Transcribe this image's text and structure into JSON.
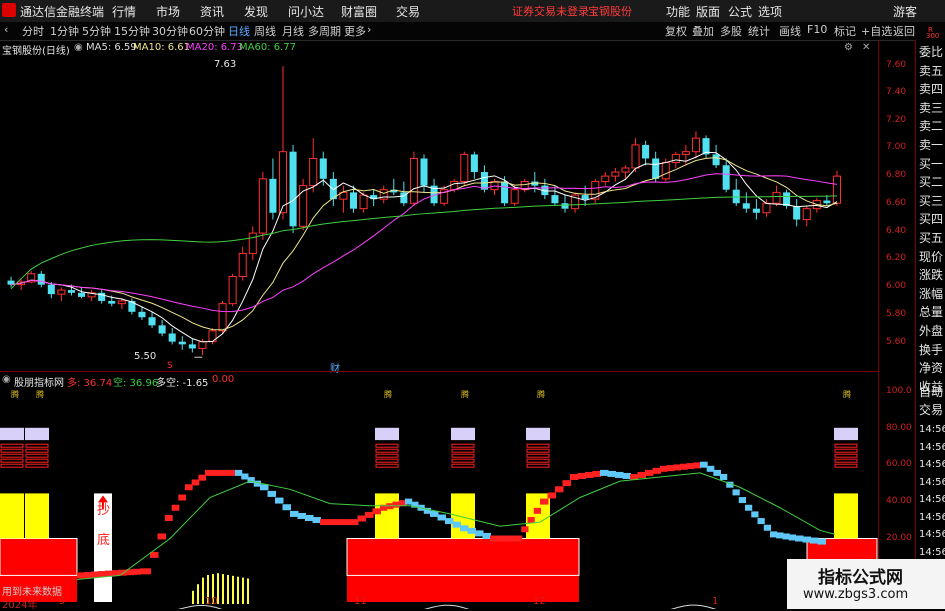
{
  "app": {
    "title": "通达信金融终端",
    "logo_color": "#d40000"
  },
  "menu": {
    "items": [
      "行情",
      "市场",
      "资讯",
      "发现",
      "问小达",
      "财富圈",
      "交易"
    ],
    "notice": "证券交易未登录",
    "stock": "宝钢股份",
    "right": [
      "功能",
      "版面",
      "公式",
      "选项"
    ],
    "user": "游客"
  },
  "toolbar": {
    "periods": [
      "分时",
      "1分钟",
      "5分钟",
      "15分钟",
      "30分钟",
      "60分钟",
      "日线",
      "周线",
      "月线",
      "多周期",
      "更多"
    ],
    "active": "日线",
    "right": [
      "复权",
      "叠加",
      "多股",
      "统计",
      "画线",
      "F10",
      "标记",
      "+自选",
      "返回"
    ]
  },
  "main_chart": {
    "title": "宝钢股份(日线)",
    "ma": [
      {
        "label": "MA5: 6.59",
        "color": "#ffffff"
      },
      {
        "label": "MA10: 6.61",
        "color": "#f0e68c"
      },
      {
        "label": "MA20: 6.73",
        "color": "#ff40ff"
      },
      {
        "label": "MA60: 6.77",
        "color": "#40d040"
      }
    ],
    "high_label": "7.63",
    "low_label": "5.50",
    "marker_s": "S",
    "marker_cai": "财",
    "y_ticks": [
      "7.60",
      "7.40",
      "7.20",
      "7.00",
      "6.80",
      "6.60",
      "6.40",
      "6.20",
      "6.00",
      "5.80",
      "5.60"
    ],
    "colors": {
      "up": "#ff3030",
      "down": "#50e0f0",
      "ma5": "#ffffff",
      "ma10": "#f0e68c",
      "ma20": "#ff40ff",
      "ma60": "#40d040"
    }
  },
  "indicator": {
    "name": "股朋指标网",
    "duo": "多: 36.74",
    "kong": "空: 36.96",
    "duokong": "多空: -1.65",
    "last": "0.00",
    "signal": "腾",
    "chao": "抄",
    "di": "底",
    "y_ticks": [
      "100.0",
      "80.00",
      "60.00",
      "40.00",
      "20.00"
    ],
    "footer": "用到未来数据"
  },
  "side_panel": {
    "top": "R",
    "top2": "300",
    "items": [
      "委比",
      "卖五",
      "卖四",
      "卖三",
      "卖二",
      "卖一",
      "买一",
      "买二",
      "买三",
      "买四",
      "买五",
      "现价",
      "涨跌",
      "涨幅",
      "总量",
      "外盘",
      "换手",
      "净资",
      "收益"
    ],
    "lower": [
      "自动",
      "交易"
    ],
    "times": [
      "14:56",
      "14:56",
      "14:56",
      "14:56",
      "14:56",
      "14:56",
      "14:56",
      "14:56",
      "14:56",
      "14:56",
      "14:56"
    ]
  },
  "x_axis": [
    "2024年",
    "9",
    "10",
    "11",
    "12",
    "1"
  ],
  "watermark": {
    "title": "指标公式网",
    "url": "www.zbgs3.com"
  },
  "chart_data": {
    "type": "candlestick",
    "title": "宝钢股份(日线)",
    "y_range": [
      5.5,
      7.63
    ],
    "candles": [
      [
        6.05,
        6.08,
        6.0,
        6.02
      ],
      [
        6.02,
        6.06,
        5.98,
        6.04
      ],
      [
        6.04,
        6.12,
        6.03,
        6.1
      ],
      [
        6.1,
        6.12,
        6.0,
        6.02
      ],
      [
        6.02,
        6.04,
        5.92,
        5.95
      ],
      [
        5.95,
        6.0,
        5.9,
        5.98
      ],
      [
        5.98,
        6.02,
        5.94,
        5.96
      ],
      [
        5.96,
        6.0,
        5.92,
        5.93
      ],
      [
        5.93,
        5.98,
        5.9,
        5.96
      ],
      [
        5.96,
        5.98,
        5.88,
        5.9
      ],
      [
        5.9,
        5.94,
        5.86,
        5.88
      ],
      [
        5.88,
        5.92,
        5.84,
        5.9
      ],
      [
        5.9,
        5.92,
        5.8,
        5.82
      ],
      [
        5.82,
        5.86,
        5.76,
        5.78
      ],
      [
        5.78,
        5.82,
        5.7,
        5.72
      ],
      [
        5.72,
        5.76,
        5.64,
        5.66
      ],
      [
        5.66,
        5.7,
        5.58,
        5.6
      ],
      [
        5.6,
        5.64,
        5.54,
        5.58
      ],
      [
        5.58,
        5.62,
        5.52,
        5.55
      ],
      [
        5.55,
        5.62,
        5.5,
        5.6
      ],
      [
        5.6,
        5.7,
        5.58,
        5.68
      ],
      [
        5.68,
        5.9,
        5.66,
        5.88
      ],
      [
        5.88,
        6.1,
        5.86,
        6.08
      ],
      [
        6.08,
        6.3,
        6.05,
        6.25
      ],
      [
        6.25,
        6.45,
        6.2,
        6.4
      ],
      [
        6.4,
        6.85,
        6.35,
        6.8
      ],
      [
        6.8,
        6.95,
        6.5,
        6.55
      ],
      [
        6.55,
        7.63,
        6.5,
        7.0
      ],
      [
        7.0,
        7.05,
        6.4,
        6.45
      ],
      [
        6.45,
        6.8,
        6.42,
        6.75
      ],
      [
        6.75,
        7.1,
        6.7,
        6.95
      ],
      [
        6.95,
        7.0,
        6.75,
        6.8
      ],
      [
        6.8,
        6.85,
        6.6,
        6.65
      ],
      [
        6.65,
        6.75,
        6.55,
        6.7
      ],
      [
        6.7,
        6.75,
        6.55,
        6.58
      ],
      [
        6.58,
        6.7,
        6.55,
        6.68
      ],
      [
        6.68,
        6.72,
        6.6,
        6.65
      ],
      [
        6.65,
        6.75,
        6.62,
        6.72
      ],
      [
        6.72,
        6.8,
        6.68,
        6.7
      ],
      [
        6.7,
        6.78,
        6.6,
        6.62
      ],
      [
        6.62,
        7.0,
        6.6,
        6.95
      ],
      [
        6.95,
        6.98,
        6.7,
        6.75
      ],
      [
        6.75,
        6.8,
        6.6,
        6.62
      ],
      [
        6.62,
        6.75,
        6.6,
        6.72
      ],
      [
        6.72,
        6.8,
        6.7,
        6.78
      ],
      [
        6.78,
        7.0,
        6.75,
        6.98
      ],
      [
        6.98,
        7.0,
        6.8,
        6.85
      ],
      [
        6.85,
        6.9,
        6.7,
        6.72
      ],
      [
        6.72,
        6.8,
        6.68,
        6.78
      ],
      [
        6.78,
        6.82,
        6.6,
        6.62
      ],
      [
        6.62,
        6.75,
        6.6,
        6.72
      ],
      [
        6.72,
        6.8,
        6.7,
        6.78
      ],
      [
        6.78,
        6.85,
        6.7,
        6.75
      ],
      [
        6.75,
        6.8,
        6.65,
        6.68
      ],
      [
        6.68,
        6.75,
        6.6,
        6.62
      ],
      [
        6.62,
        6.68,
        6.55,
        6.58
      ],
      [
        6.58,
        6.7,
        6.55,
        6.68
      ],
      [
        6.68,
        6.75,
        6.6,
        6.65
      ],
      [
        6.65,
        6.8,
        6.62,
        6.78
      ],
      [
        6.78,
        6.85,
        6.75,
        6.82
      ],
      [
        6.82,
        6.88,
        6.78,
        6.85
      ],
      [
        6.85,
        6.9,
        6.8,
        6.88
      ],
      [
        6.88,
        7.1,
        6.85,
        7.05
      ],
      [
        7.05,
        7.08,
        6.9,
        6.95
      ],
      [
        6.95,
        7.0,
        6.78,
        6.8
      ],
      [
        6.8,
        6.95,
        6.78,
        6.92
      ],
      [
        6.92,
        7.0,
        6.88,
        6.98
      ],
      [
        6.98,
        7.05,
        6.9,
        7.0
      ],
      [
        7.0,
        7.15,
        6.95,
        7.1
      ],
      [
        7.1,
        7.12,
        6.95,
        6.98
      ],
      [
        6.98,
        7.05,
        6.88,
        6.9
      ],
      [
        6.9,
        6.95,
        6.7,
        6.72
      ],
      [
        6.72,
        6.8,
        6.6,
        6.62
      ],
      [
        6.62,
        6.7,
        6.55,
        6.58
      ],
      [
        6.58,
        6.65,
        6.5,
        6.55
      ],
      [
        6.55,
        6.65,
        6.52,
        6.62
      ],
      [
        6.62,
        6.75,
        6.6,
        6.7
      ],
      [
        6.7,
        6.72,
        6.58,
        6.6
      ],
      [
        6.6,
        6.65,
        6.45,
        6.5
      ],
      [
        6.5,
        6.6,
        6.45,
        6.58
      ],
      [
        6.58,
        6.66,
        6.55,
        6.64
      ],
      [
        6.64,
        6.68,
        6.6,
        6.62
      ],
      [
        6.62,
        6.86,
        6.6,
        6.82
      ]
    ],
    "indicator_series": {
      "duo": 36.74,
      "kong": 36.96,
      "duokong": -1.65
    }
  }
}
